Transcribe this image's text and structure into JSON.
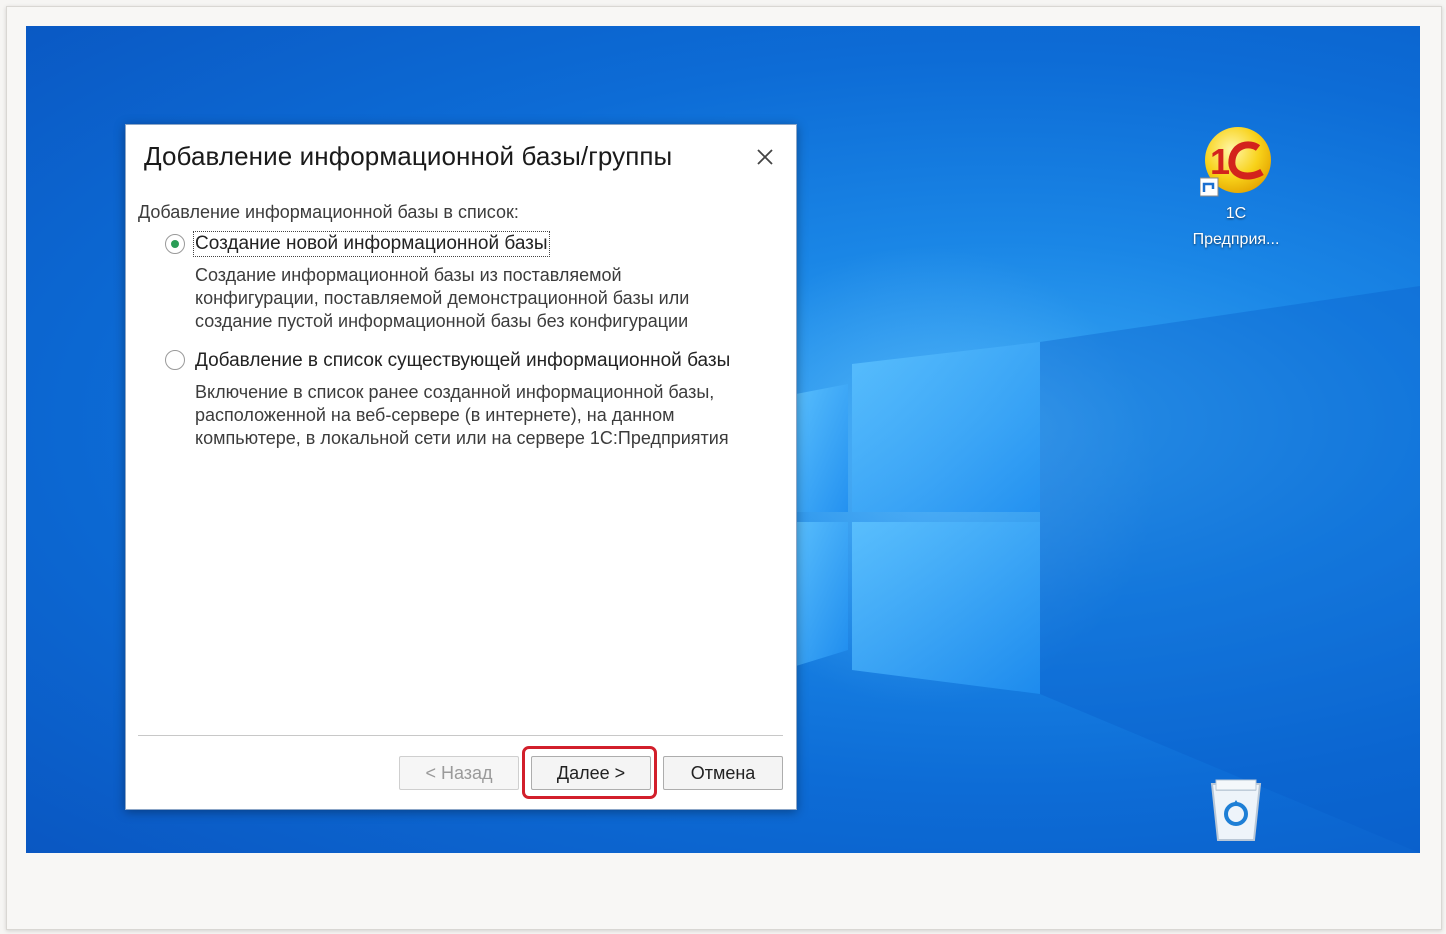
{
  "dialog": {
    "title": "Добавление информационной базы/группы",
    "prompt": "Добавление информационной базы в список:",
    "options": [
      {
        "label": "Создание новой информационной базы",
        "selected": true,
        "description": [
          "Создание информационной базы из поставляемой",
          "конфигурации, поставляемой демонстрационной базы или",
          "создание пустой информационной базы без конфигурации"
        ]
      },
      {
        "label": "Добавление в список существующей информационной базы",
        "selected": false,
        "description": [
          "Включение в список ранее созданной информационной базы,",
          "расположенной на веб-сервере (в интернете), на данном",
          "компьютере,  в локальной сети или на сервере 1С:Предприятия"
        ]
      }
    ],
    "buttons": {
      "back": "< Назад",
      "next": "Далее >",
      "cancel": "Отмена"
    }
  },
  "desktop": {
    "icons": [
      {
        "line1": "1С",
        "line2": "Предприя..."
      }
    ]
  },
  "colors": {
    "accent_highlight": "#d21f2b",
    "radio_selected": "#2a9d56",
    "desktop_blue": "#0d6cd6"
  }
}
